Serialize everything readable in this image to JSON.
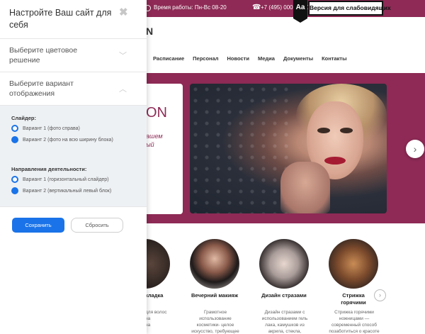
{
  "topbar": {
    "hours": "Время работы: Пн-Вс 08-20",
    "phone": "+7 (495) 000-00-00",
    "a11y_icon": "Aa",
    "a11y_button": "Версия для слабовидящих"
  },
  "site": {
    "logo_tail": "N",
    "nav": [
      "Расписание",
      "Персонал",
      "Новости",
      "Медиа",
      "Документы",
      "Контакты"
    ],
    "hero": {
      "title_tail": "ON",
      "subtitle_tail": "ашем\nый"
    },
    "services": [
      {
        "title": "кладка",
        "desc": "для волос\nна\nна"
      },
      {
        "title": "Вечерний макияж",
        "desc": "Грамотное\nиспользование\nкосметики- целое\nискусство, требующее"
      },
      {
        "title": "Дизайн стразами",
        "desc": "Дизайн стразами с\nиспользованием гель\nлака, камушков из\nакрила, стекла,"
      },
      {
        "title": "Стрижка\nгорячими",
        "desc": "Стрижка горячими\nножницами —\nсовременный способ\nпозаботиться о красоте"
      }
    ]
  },
  "panel": {
    "title": "Настройте Ваш сайт для себя",
    "close_icon": "close-icon",
    "accordion": [
      {
        "label": "Выберите цветовое решение",
        "chevron": "chevron-down-icon"
      },
      {
        "label": "Выберите вариант отображения",
        "chevron": "chevron-up-icon"
      }
    ],
    "slider_group": {
      "label": "Слайдер:",
      "options": [
        "Вариант 1 (фото справа)",
        "Вариант 2 (фото на всю ширину блока)"
      ],
      "selected": 0
    },
    "direction_group": {
      "label": "Направления деятельности:",
      "options": [
        "Вариант 1 (горизонтальный слайдер)",
        "Вариант 2 (вертикальный левый блок)"
      ],
      "selected": 0
    },
    "save_button": "Сохранить",
    "reset_button": "Сбросить"
  },
  "colors": {
    "brand": "#8e2a55",
    "accent": "#1a73e8"
  }
}
